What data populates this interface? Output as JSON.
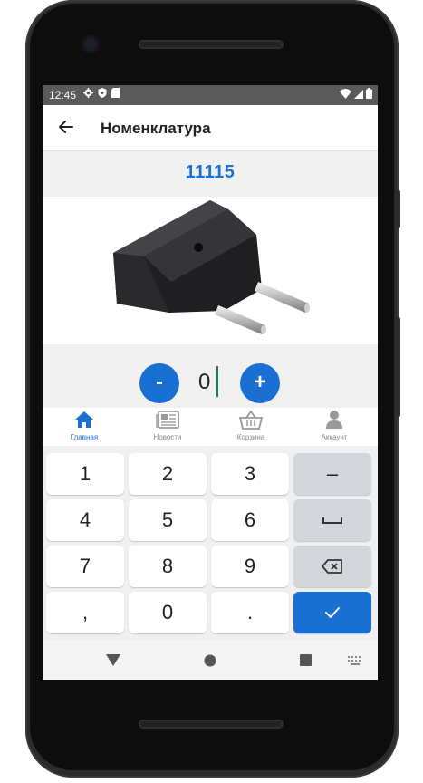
{
  "status_bar": {
    "time": "12:45",
    "left_icons": [
      "settings-icon",
      "shield-icon",
      "sd-card-icon"
    ],
    "right_icons": [
      "wifi-icon",
      "signal-icon",
      "battery-icon"
    ]
  },
  "app_bar": {
    "title": "Номенклатура",
    "back_icon": "arrow-back-icon"
  },
  "product": {
    "code": "11115",
    "image": "black power plug adapter"
  },
  "quantity": {
    "minus_label": "-",
    "value": "0",
    "plus_label": "+"
  },
  "bottom_nav": {
    "items": [
      {
        "label": "Главная",
        "icon": "home-icon",
        "active": true
      },
      {
        "label": "Новости",
        "icon": "newspaper-icon",
        "active": false
      },
      {
        "label": "Корзина",
        "icon": "basket-icon",
        "active": false
      },
      {
        "label": "Аккаунт",
        "icon": "user-icon",
        "active": false
      }
    ]
  },
  "keyboard": {
    "rows": [
      [
        "1",
        "2",
        "3",
        "–"
      ],
      [
        "4",
        "5",
        "6",
        "␣"
      ],
      [
        "7",
        "8",
        "9",
        "⌫"
      ],
      [
        ",",
        "0",
        ".",
        "✓"
      ]
    ]
  },
  "system_nav": {
    "icons": [
      "back-triangle-icon",
      "home-circle-icon",
      "recents-square-icon",
      "keyboard-switch-icon"
    ]
  },
  "colors": {
    "accent": "#1a6fd3",
    "code_text": "#1a73d9",
    "status_bar": "#5a5a5a",
    "panel": "#f0f0f0"
  }
}
